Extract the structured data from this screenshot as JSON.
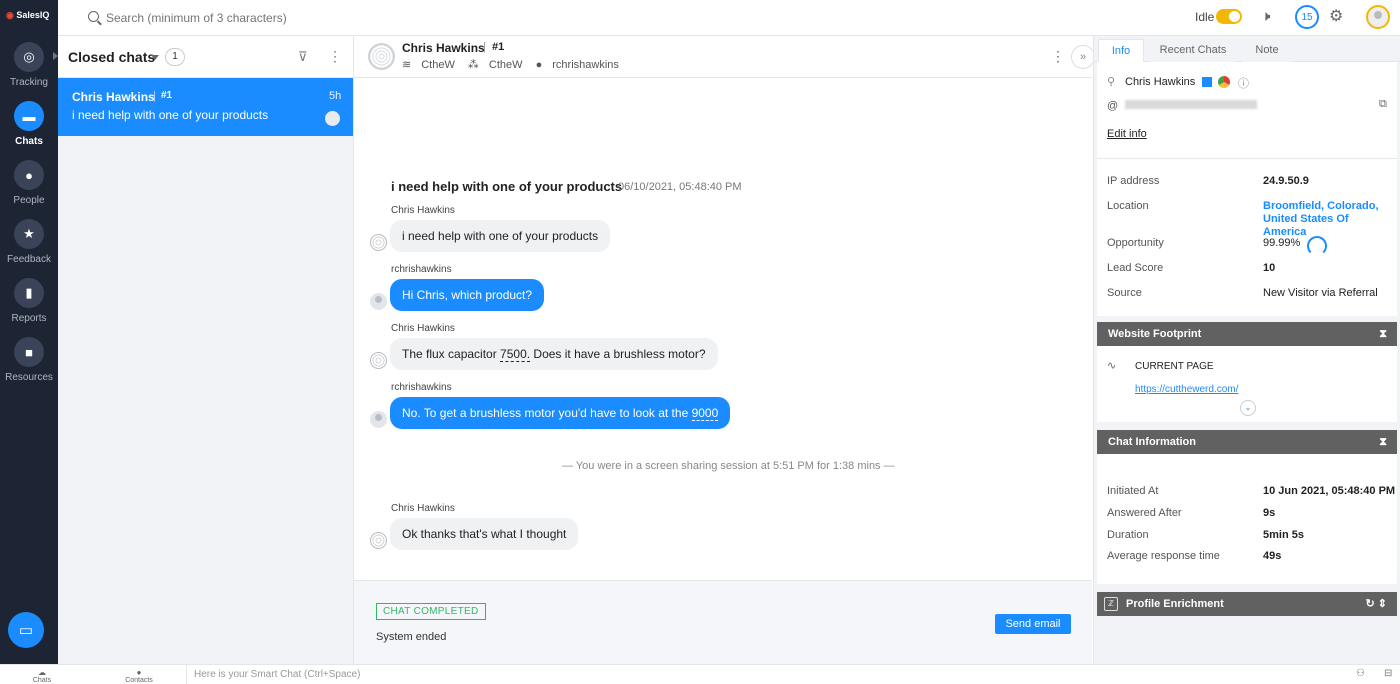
{
  "app": {
    "brand": "SalesIQ"
  },
  "nav": {
    "items": [
      {
        "label": "Tracking",
        "icon": "target-icon"
      },
      {
        "label": "Chats",
        "icon": "chat-icon"
      },
      {
        "label": "People",
        "icon": "person-icon"
      },
      {
        "label": "Feedback",
        "icon": "star-icon"
      },
      {
        "label": "Reports",
        "icon": "bar-chart-icon"
      },
      {
        "label": "Resources",
        "icon": "briefcase-icon"
      }
    ],
    "active": "Chats"
  },
  "topbar": {
    "search_placeholder": "Search (minimum of 3 characters)",
    "status": "Idle",
    "notification_count": "15"
  },
  "list": {
    "title": "Closed chats",
    "count": "1",
    "items": [
      {
        "name": "Chris Hawkins",
        "sep": "|",
        "num": "#1",
        "message": "i need help with one of your products",
        "time": "5h"
      }
    ]
  },
  "conversation": {
    "name": "Chris Hawkins",
    "sep": "|",
    "num": "#1",
    "meta": {
      "department": "CtheW",
      "portal": "CtheW",
      "operator": "rchrishawkins"
    },
    "question": "i need help with one of your products",
    "question_time": "06/10/2021, 05:48:40 PM",
    "messages": [
      {
        "sender": "Chris Hawkins",
        "text": "i need help with one of your products",
        "dir": "in"
      },
      {
        "sender": "rchrishawkins",
        "text": "Hi Chris, which product?",
        "dir": "out"
      },
      {
        "sender": "Chris Hawkins",
        "text_pre": "The flux capacitor ",
        "text_link": "7500.",
        "text_post": " Does it have a brushless motor?",
        "dir": "in"
      },
      {
        "sender": "rchrishawkins",
        "text_pre": "No. To get a brushless motor you'd have to look at the ",
        "text_link": "9000",
        "dir": "out"
      },
      {
        "sender": "Chris Hawkins",
        "text": "Ok thanks that's what I thought",
        "dir": "in"
      }
    ],
    "system_line": "—  You were in a screen sharing session at 5:51 PM for 1:38 mins  —",
    "completed_badge": "CHAT COMPLETED",
    "system_ended": "System ended",
    "send_email": "Send email"
  },
  "right": {
    "tabs": [
      "Info",
      "Recent Chats",
      "Note"
    ],
    "active_tab": "Info",
    "visitor": {
      "name": "Chris Hawkins",
      "edit": "Edit info",
      "email_prefix": "@"
    },
    "details": [
      {
        "label": "IP address",
        "value": "24.9.50.9"
      },
      {
        "label": "Location",
        "value": "Broomfield, Colorado, United States Of America"
      },
      {
        "label": "Opportunity",
        "value": "99.99%"
      },
      {
        "label": "Lead Score",
        "value": "10"
      },
      {
        "label": "Source",
        "value": "New Visitor via Referral"
      }
    ],
    "footprint": {
      "title": "Website Footprint",
      "current_page_label": "CURRENT PAGE",
      "url": "https://cutthewerd.com/"
    },
    "chat_info": {
      "title": "Chat Information",
      "rows": [
        {
          "label": "Initiated At",
          "value": "10 Jun 2021, 05:48:40 PM"
        },
        {
          "label": "Answered After",
          "value": "9s"
        },
        {
          "label": "Duration",
          "value": "5min 5s"
        },
        {
          "label": "Average response time",
          "value": "49s"
        }
      ]
    },
    "enrichment": {
      "title": "Profile Enrichment"
    }
  },
  "bottombar": {
    "chats": "Chats",
    "contacts": "Contacts",
    "smart_chat": "Here is your Smart Chat (Ctrl+Space)"
  },
  "colors": {
    "accent": "#1a8cff",
    "nav_bg": "#1d2433",
    "idle": "#f2b705",
    "completed": "#2fb866"
  }
}
